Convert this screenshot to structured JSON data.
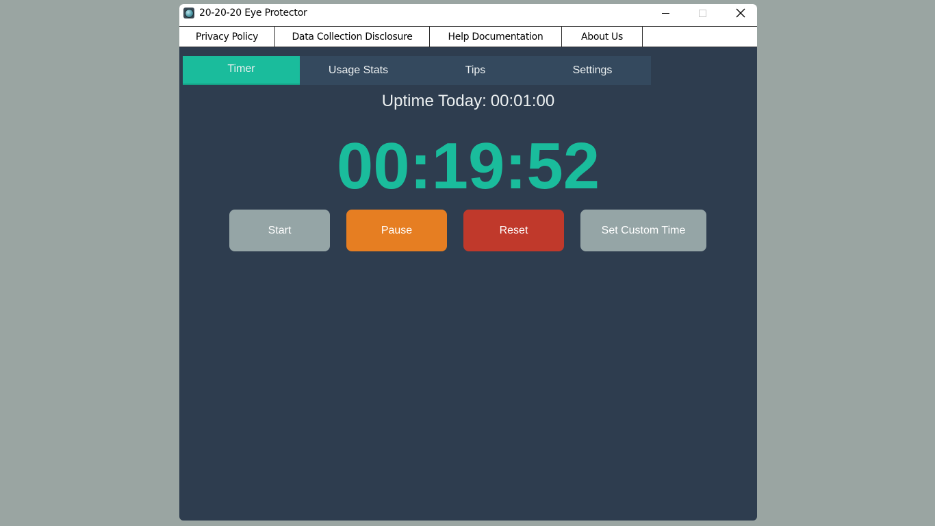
{
  "window": {
    "title": "20-20-20 Eye Protector",
    "icon": "globe-app-icon"
  },
  "menu": {
    "items": [
      {
        "label": "Privacy Policy"
      },
      {
        "label": "Data Collection Disclosure"
      },
      {
        "label": "Help Documentation"
      },
      {
        "label": "About Us"
      }
    ]
  },
  "tabs": [
    {
      "label": "Timer",
      "active": true
    },
    {
      "label": "Usage Stats",
      "active": false
    },
    {
      "label": "Tips",
      "active": false
    },
    {
      "label": "Settings",
      "active": false
    }
  ],
  "uptime": {
    "label": "Uptime Today:",
    "value": "00:01:00"
  },
  "timer": {
    "value": "00:19:52"
  },
  "buttons": {
    "start": "Start",
    "pause": "Pause",
    "reset": "Reset",
    "custom": "Set Custom Time"
  },
  "colors": {
    "background": "#2e3d4f",
    "tab_bar": "#34495e",
    "accent": "#1abc9c",
    "start": "#95a5a6",
    "pause": "#e67e22",
    "reset": "#c0392b",
    "custom": "#95a5a6",
    "desktop": "#9aa5a2"
  }
}
